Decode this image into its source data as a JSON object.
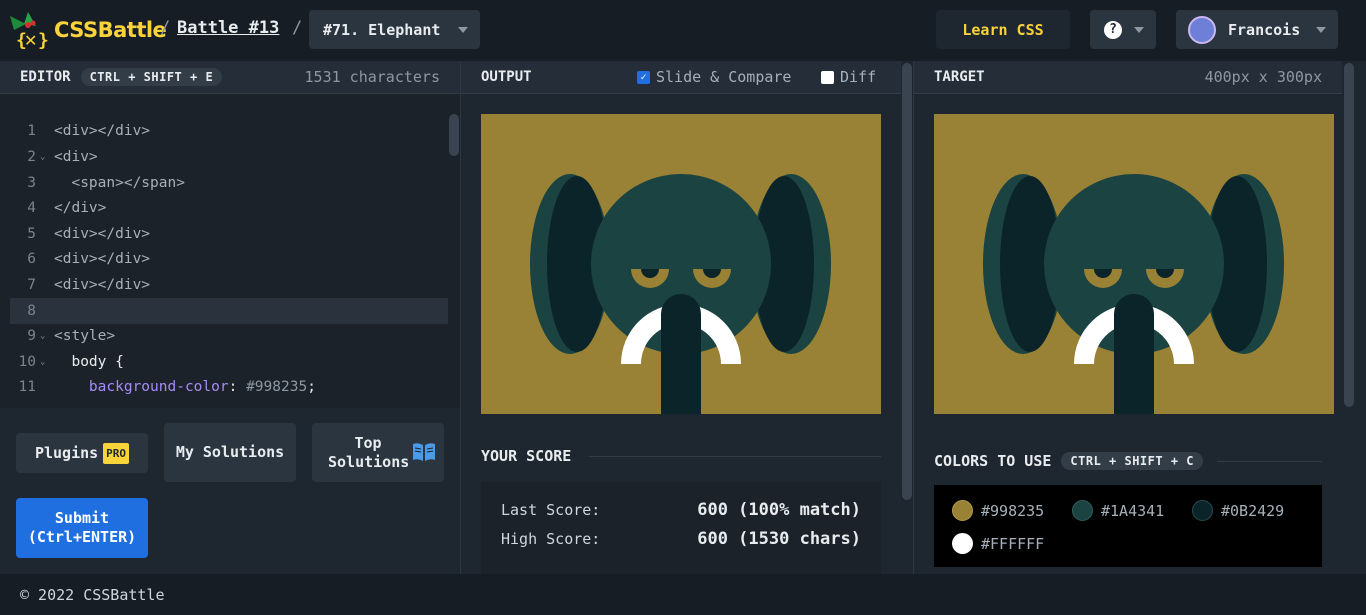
{
  "header": {
    "logo_text": "CSSBattle",
    "battle_link": "Battle #13",
    "target_select": "#71. Elephant",
    "learn_button": "Learn CSS",
    "help_label": "?",
    "user_name": "Francois"
  },
  "editor": {
    "title": "EDITOR",
    "shortcut": "CTRL + SHIFT + E",
    "char_count": "1531 characters",
    "lines": [
      {
        "n": "1",
        "text": "<div></div>"
      },
      {
        "n": "2",
        "text": "<div>"
      },
      {
        "n": "3",
        "text": "  <span></span>"
      },
      {
        "n": "4",
        "text": "</div>"
      },
      {
        "n": "5",
        "text": "<div></div>"
      },
      {
        "n": "6",
        "text": "<div></div>"
      },
      {
        "n": "7",
        "text": "<div></div>"
      },
      {
        "n": "8",
        "text": ""
      },
      {
        "n": "9",
        "text": "<style>"
      },
      {
        "n": "10",
        "text": "  body {"
      },
      {
        "n": "11",
        "prop": "    background-color",
        "val": "#998235"
      }
    ]
  },
  "buttons": {
    "plugins": "Plugins",
    "pro_badge": "PRO",
    "my_solutions": "My Solutions",
    "top_solutions": "Top Solutions",
    "submit_line1": "Submit",
    "submit_line2": "(Ctrl+ENTER)"
  },
  "output": {
    "title": "OUTPUT",
    "slide_compare": "Slide & Compare",
    "diff": "Diff"
  },
  "target": {
    "title": "TARGET",
    "size": "400px x 300px"
  },
  "score": {
    "title": "YOUR SCORE",
    "last_label": "Last Score:",
    "last_value": "600 (100% match)",
    "high_label": "High Score:",
    "high_value": "600 (1530 chars)"
  },
  "colors": {
    "title": "COLORS TO USE",
    "shortcut": "CTRL + SHIFT + C",
    "items": [
      {
        "hex": "#998235"
      },
      {
        "hex": "#1A4341"
      },
      {
        "hex": "#0B2429"
      },
      {
        "hex": "#FFFFFF"
      }
    ]
  },
  "footer": {
    "copyright": "© 2022 CSSBattle"
  },
  "palette": {
    "bg": "#998235",
    "green": "#1A4341",
    "dark": "#0B2429",
    "white": "#FFFFFF",
    "accent_yellow": "#f8d33a",
    "submit_blue": "#1f6fe0"
  }
}
